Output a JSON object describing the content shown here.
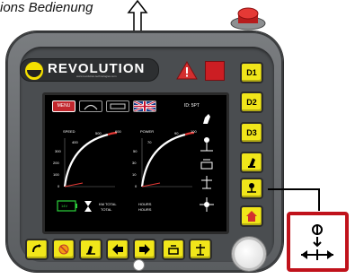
{
  "caption": {
    "text": "ions Bedienung"
  },
  "brand": {
    "name": "REVOLUTION",
    "subtext": "www.revolution-technologies.com"
  },
  "screen": {
    "tab_menu": "MENU",
    "id_label": "ID: 5PT",
    "speed_label": "SPEED",
    "power_label": "POWER",
    "speed_ticks": [
      "0",
      "100",
      "200",
      "300",
      "400",
      "500",
      "600"
    ],
    "power_ticks": [
      "0",
      "10",
      "30",
      "50",
      "70",
      "90",
      "100"
    ],
    "battery_value": "14V",
    "km_total_label": "KM TOTAL",
    "total_label": "TOTAL",
    "hours_label": "HOURS",
    "hours_label2": "HOURS"
  },
  "right_buttons": [
    "D1",
    "D2",
    "D3"
  ],
  "colors": {
    "button_yellow": "#f1e61a",
    "accent_red": "#c1272d",
    "housing_grey": "#5a5d60"
  }
}
